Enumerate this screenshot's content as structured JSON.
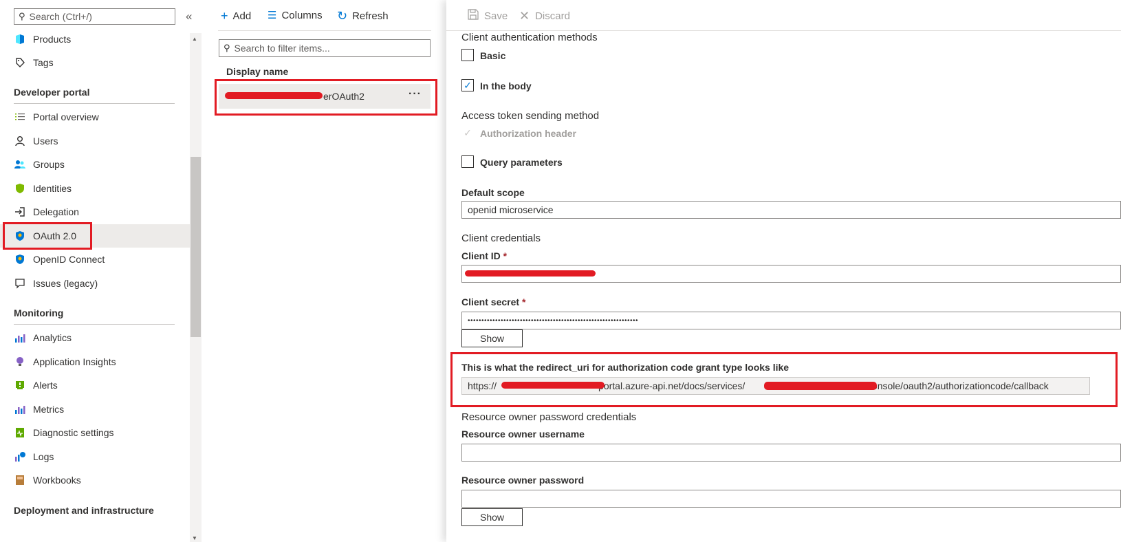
{
  "nav": {
    "search_placeholder": "Search (Ctrl+/)",
    "collapse_glyph": "«",
    "items_top": [
      {
        "label": "Products"
      },
      {
        "label": "Tags"
      }
    ],
    "sections": [
      {
        "header": "Developer portal"
      },
      {
        "header": "Monitoring"
      },
      {
        "header": "Deployment and infrastructure"
      }
    ],
    "dev_items": [
      {
        "label": "Portal overview"
      },
      {
        "label": "Users"
      },
      {
        "label": "Groups"
      },
      {
        "label": "Identities"
      },
      {
        "label": "Delegation"
      },
      {
        "label": "OAuth 2.0"
      },
      {
        "label": "OpenID Connect"
      },
      {
        "label": "Issues (legacy)"
      }
    ],
    "mon_items": [
      {
        "label": "Analytics"
      },
      {
        "label": "Application Insights"
      },
      {
        "label": "Alerts"
      },
      {
        "label": "Metrics"
      },
      {
        "label": "Diagnostic settings"
      },
      {
        "label": "Logs"
      },
      {
        "label": "Workbooks"
      }
    ]
  },
  "mid": {
    "toolbar": {
      "add": "Add",
      "columns": "Columns",
      "refresh": "Refresh"
    },
    "filter_placeholder": "Search to filter items...",
    "column_header": "Display name",
    "row_text": "erOAuth2",
    "row_more": "···"
  },
  "right": {
    "cmd": {
      "save": "Save",
      "discard": "Discard"
    },
    "client_auth_methods": "Client authentication methods",
    "basic": "Basic",
    "in_body": "In the body",
    "access_token_method": "Access token sending method",
    "auth_header": "Authorization header",
    "query_params": "Query parameters",
    "default_scope_label": "Default scope",
    "default_scope_value": "openid microservice",
    "client_credentials": "Client credentials",
    "client_id_label": "Client ID",
    "client_secret_label": "Client secret",
    "client_secret_value": "••••••••••••••••••••••••••••••••••••••••••••••••••••••••••••••",
    "required_mark": "*",
    "show": "Show",
    "redirect_label": "This is what the redirect_uri for authorization code grant type looks like",
    "redirect_part1": "https://",
    "redirect_part2": "portal.azure-api.net/docs/services/",
    "redirect_part3": "h/console/oauth2/authorizationcode/callback",
    "ro_password_creds": "Resource owner password credentials",
    "ro_username_label": "Resource owner username",
    "ro_password_label": "Resource owner password",
    "show2": "Show"
  },
  "colors": {
    "accent": "#0078d4",
    "highlight": "#e21b23",
    "selected": "#edebe9"
  }
}
